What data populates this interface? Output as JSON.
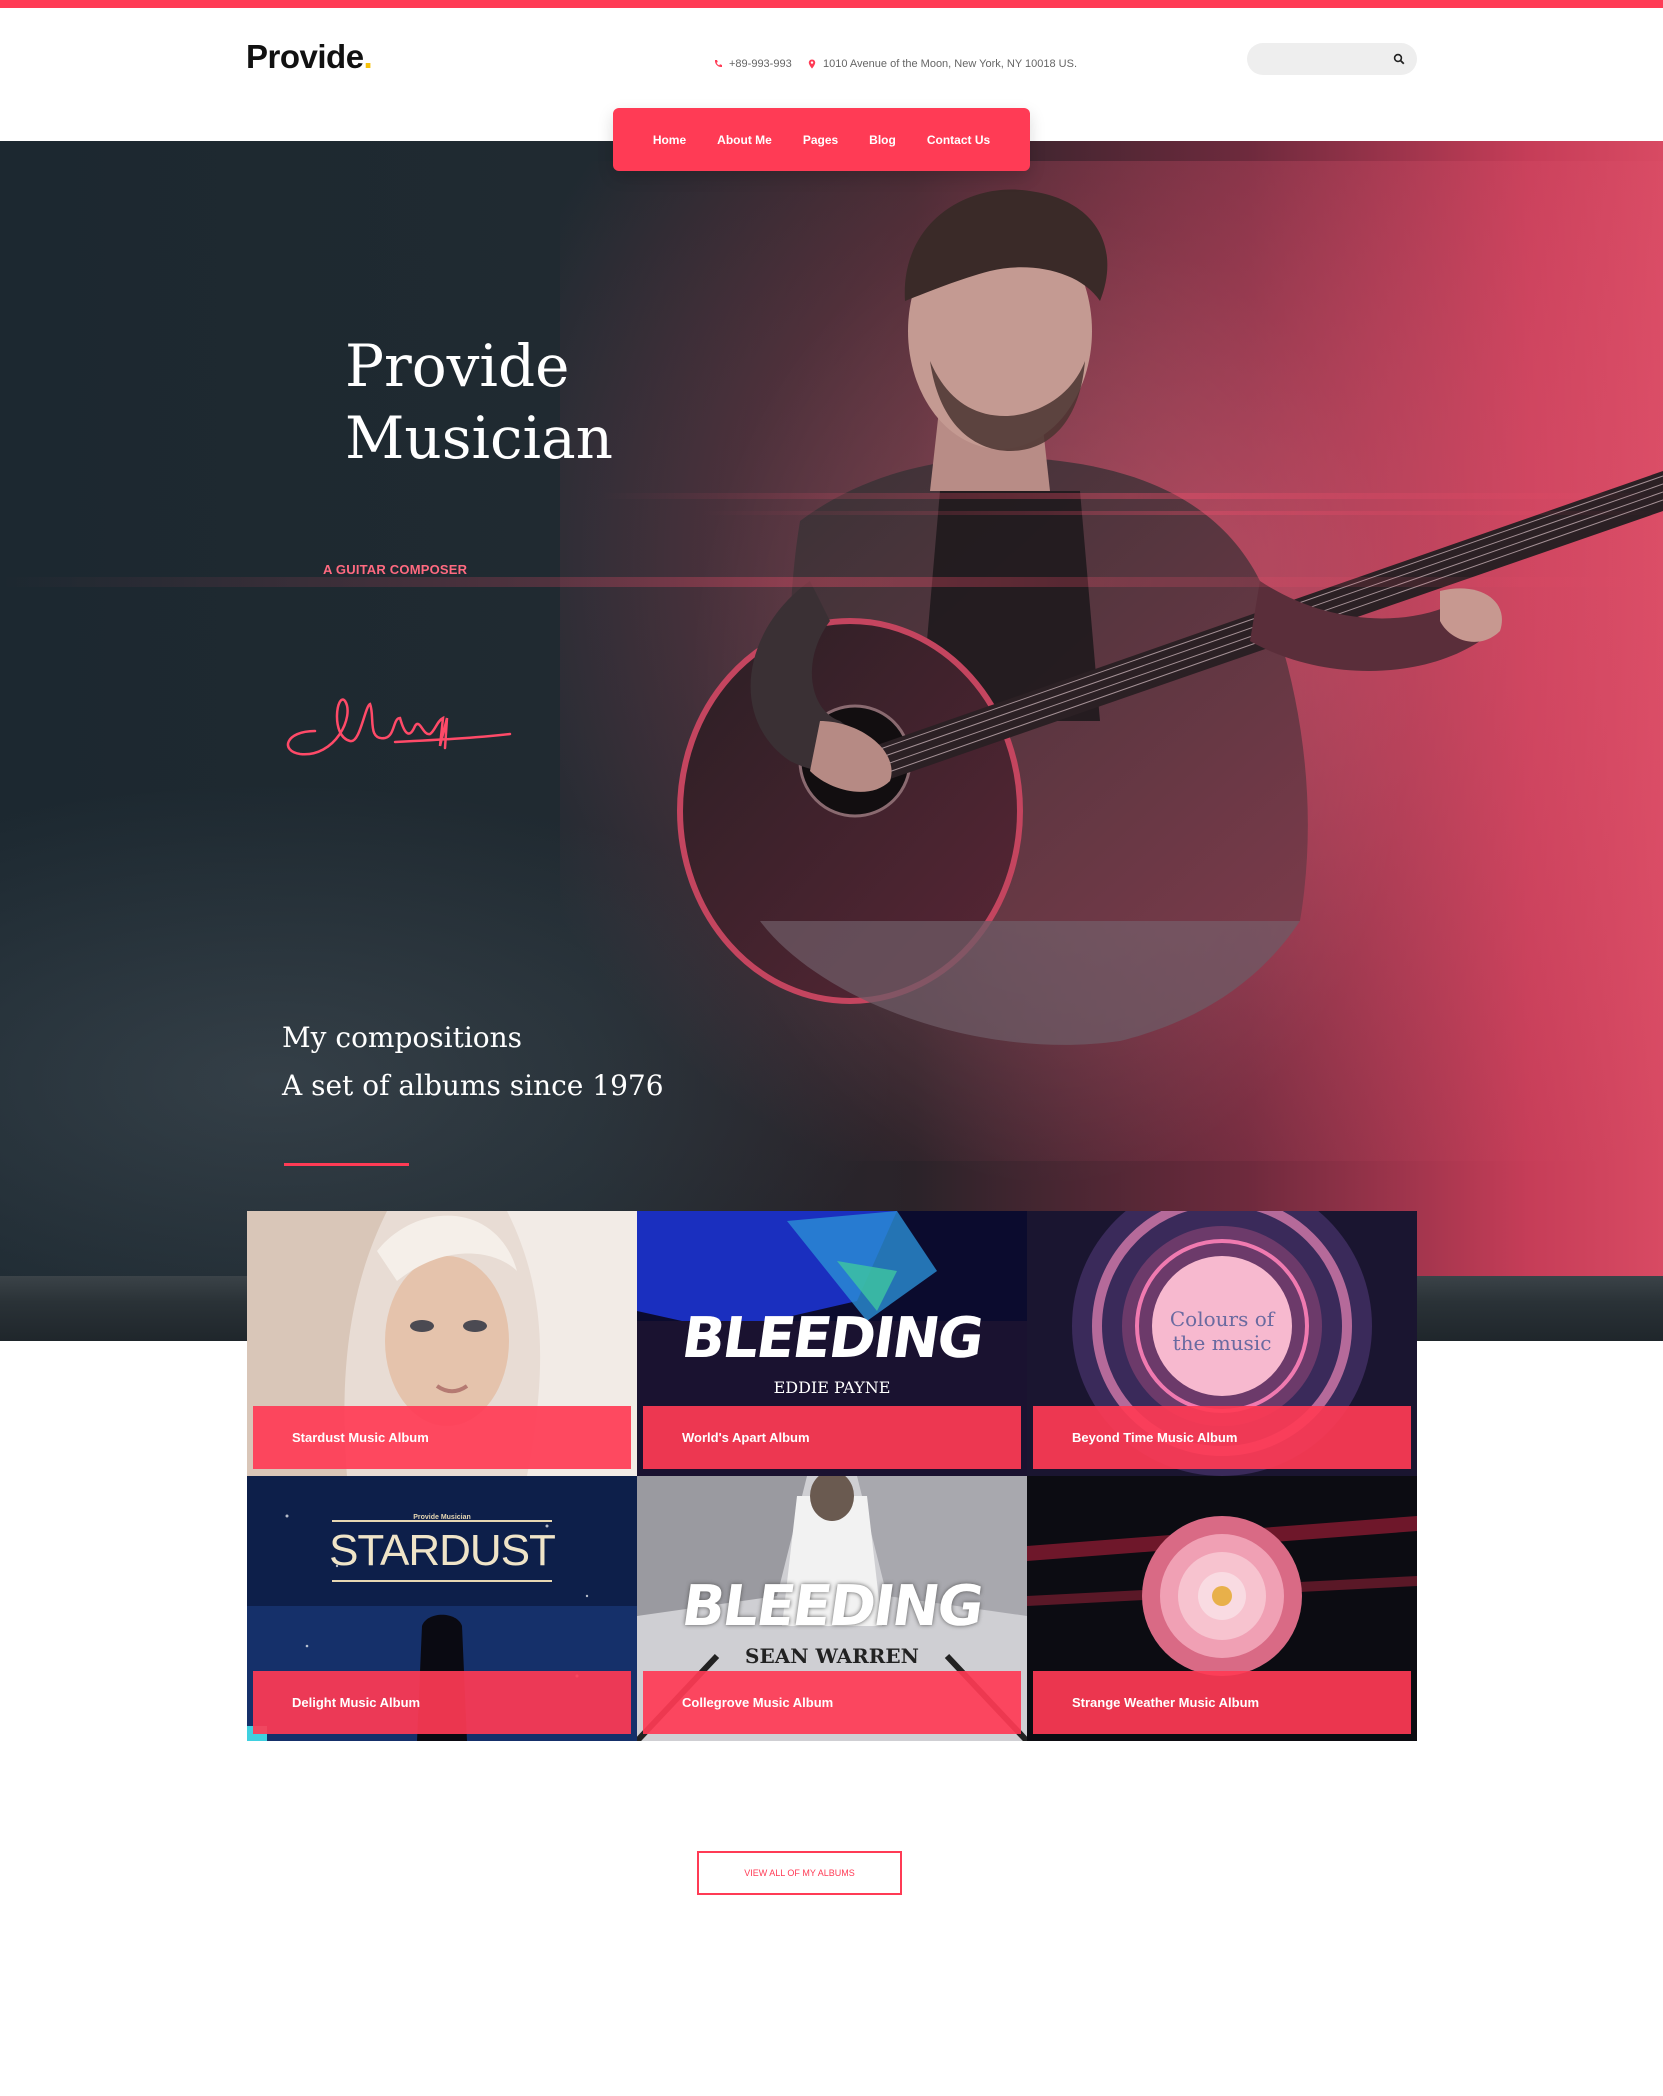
{
  "header": {
    "logo": "Provide",
    "logo_dot": ".",
    "phone": "+89-993-993",
    "address": "1010 Avenue of the Moon, New York, NY 10018 US.",
    "search_placeholder": ""
  },
  "nav": {
    "items": [
      "Home",
      "About Me",
      "Pages",
      "Blog",
      "Contact Us"
    ]
  },
  "hero": {
    "title_line1": "Provide",
    "title_line2": "Musician",
    "subtitle": "A GUITAR COMPOSER",
    "compositions_line1": "My compositions",
    "compositions_line2": "A set of albums since 1976"
  },
  "albums": [
    {
      "title": "Stardust Music Album"
    },
    {
      "title": "World's Apart Album",
      "cover_text": "BLEEDING",
      "cover_subtext": "EDDIE PAYNE"
    },
    {
      "title": "Beyond Time Music Album",
      "cover_text": "Colours of",
      "cover_subtext": "the music"
    },
    {
      "title": "Delight Music Album",
      "cover_kicker": "Provide Musician",
      "cover_text": "STARDUST"
    },
    {
      "title": "Collegrove Music Album",
      "cover_text": "BLEEDING",
      "cover_subtext": "SEAN WARREN"
    },
    {
      "title": "Strange Weather Music Album"
    }
  ],
  "cta": {
    "label": "VIEW ALL OF MY ALBUMS"
  },
  "colors": {
    "accent": "#ff3b55",
    "logo_dot": "#f7c20a",
    "hero_dark": "#1f2a31"
  }
}
